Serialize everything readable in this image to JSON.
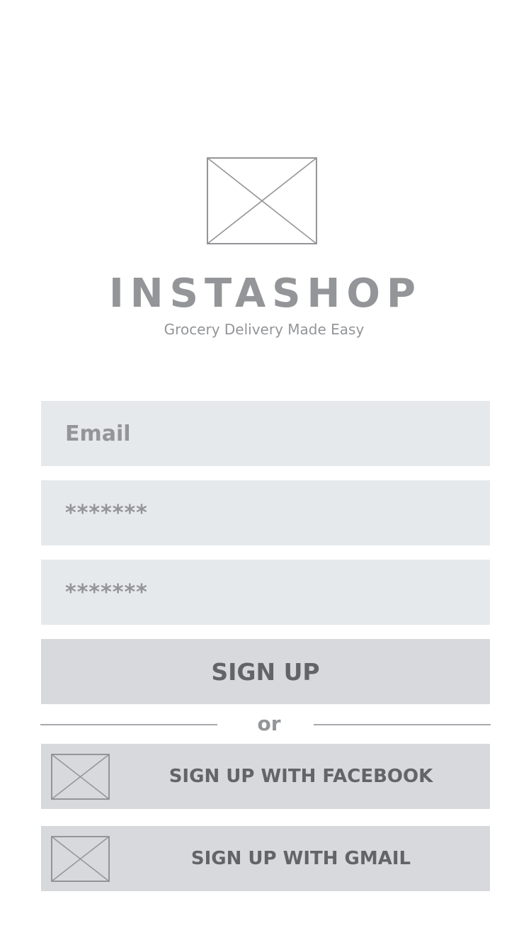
{
  "header": {
    "logo_icon": "image-placeholder-icon",
    "app_name": "INSTASHOP",
    "tagline": "Grocery Delivery Made Easy"
  },
  "form": {
    "email_placeholder": "Email",
    "password_value": "*******",
    "confirm_password_value": "*******",
    "submit_label": "SIGN UP"
  },
  "divider": {
    "label": "or"
  },
  "social": {
    "facebook": {
      "icon": "image-placeholder-icon",
      "label": "SIGN UP WITH FACEBOOK"
    },
    "gmail": {
      "icon": "image-placeholder-icon",
      "label": "SIGN UP WITH GMAIL"
    }
  },
  "colors": {
    "text_gray": "#939598",
    "dark_text": "#636466",
    "input_bg": "#e6e9ec",
    "button_bg": "#d7d9dc",
    "line": "#a7a9ac"
  }
}
